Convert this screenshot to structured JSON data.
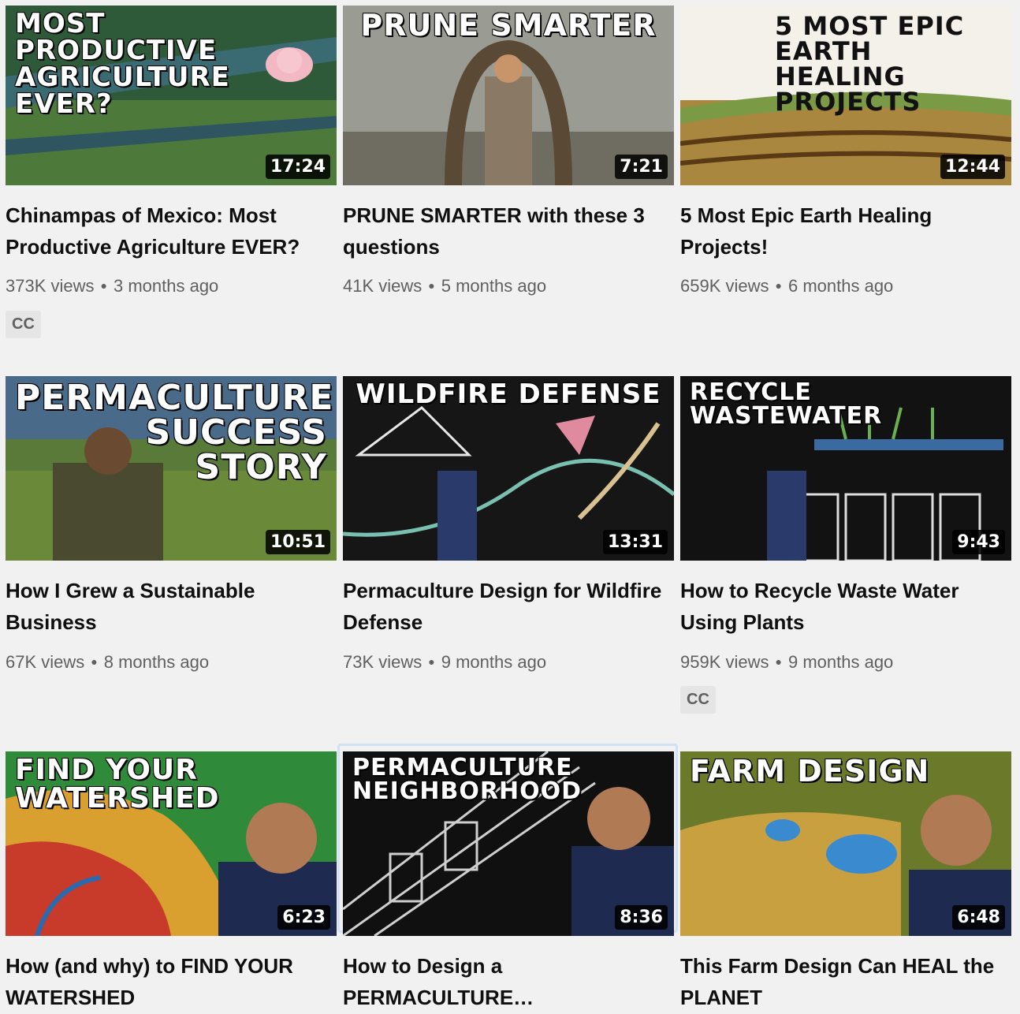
{
  "videos": [
    {
      "thumb_text": "Most Productive Agriculture Ever?",
      "duration": "17:24",
      "title": "Chinampas of Mexico: Most Productive Agriculture EVER?",
      "views": "373K views",
      "age": "3 months ago",
      "badge": "CC"
    },
    {
      "thumb_text": "Prune Smarter",
      "duration": "7:21",
      "title": "PRUNE SMARTER with these 3 questions",
      "views": "41K views",
      "age": "5 months ago",
      "badge": ""
    },
    {
      "thumb_text": "5 Most Epic Earth Healing Projects",
      "duration": "12:44",
      "title": "5 Most Epic Earth Healing Projects!",
      "views": "659K views",
      "age": "6 months ago",
      "badge": ""
    },
    {
      "thumb_text": "Permaculture Success Story",
      "duration": "10:51",
      "title": "How I Grew a Sustainable Business",
      "views": "67K views",
      "age": "8 months ago",
      "badge": ""
    },
    {
      "thumb_text": "Wildfire Defense",
      "duration": "13:31",
      "title": "Permaculture Design for Wildfire Defense",
      "views": "73K views",
      "age": "9 months ago",
      "badge": ""
    },
    {
      "thumb_text": "Recycle Wastewater",
      "duration": "9:43",
      "title": "How to Recycle Waste Water Using Plants",
      "views": "959K views",
      "age": "9 months ago",
      "badge": "CC"
    },
    {
      "thumb_text": "Find Your Watershed",
      "duration": "6:23",
      "title": "How (and why) to FIND YOUR WATERSHED",
      "views": "",
      "age": "",
      "badge": ""
    },
    {
      "thumb_text": "Permaculture Neighborhood",
      "duration": "8:36",
      "title": "How to Design a PERMACULTURE…",
      "views": "",
      "age": "",
      "badge": ""
    },
    {
      "thumb_text": "Farm Design",
      "duration": "6:48",
      "title": "This Farm Design Can HEAL the PLANET",
      "views": "",
      "age": "",
      "badge": ""
    }
  ],
  "thumb_colors": [
    [
      "#2f5a3a",
      "#6b8f4a"
    ],
    [
      "#8a8f86",
      "#b7b3a5"
    ],
    [
      "#c9a25a",
      "#8a6a35"
    ],
    [
      "#5a7a3a",
      "#9ab85a"
    ],
    [
      "#151515",
      "#2a2a2a"
    ],
    [
      "#141414",
      "#222222"
    ],
    [
      "#2f8a3a",
      "#d9a030"
    ],
    [
      "#101010",
      "#1e1e1e"
    ],
    [
      "#6a7a2a",
      "#c8a040"
    ]
  ]
}
